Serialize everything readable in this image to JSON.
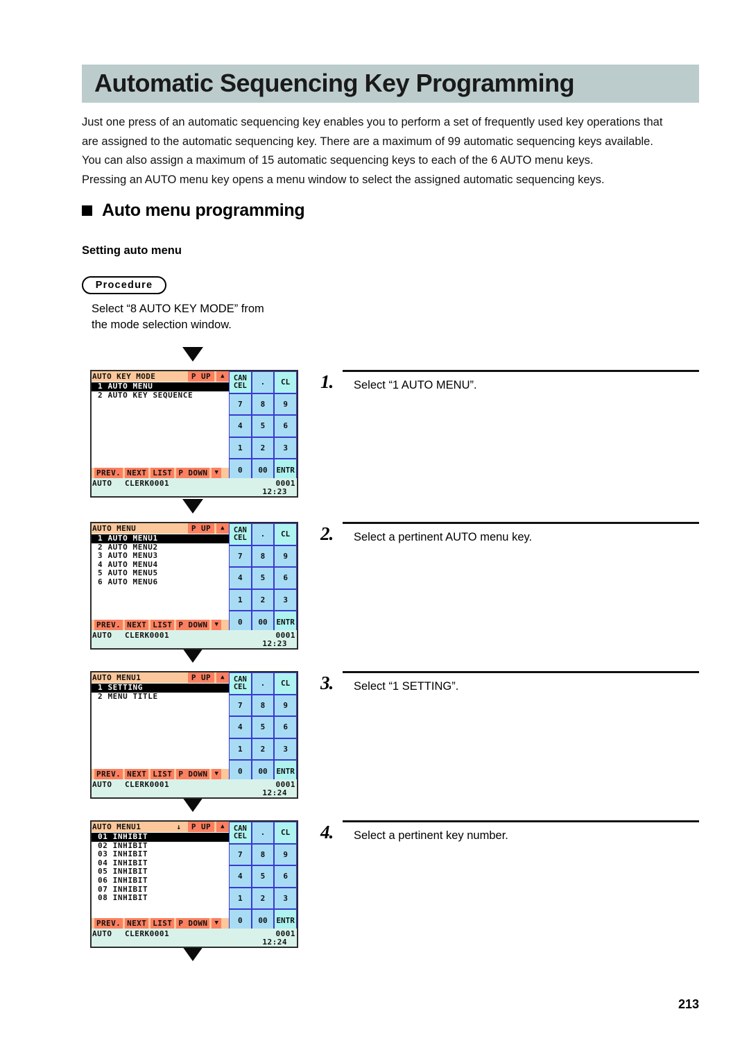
{
  "page": {
    "title": "Automatic Sequencing Key Programming",
    "page_number": "213",
    "banner_color": "#bccccd"
  },
  "intro": {
    "lines": [
      "Just one press of an automatic sequencing key enables you to perform a set of frequently used key operations that",
      "are assigned to the automatic sequencing key. There are a maximum of 99 automatic sequencing keys available.",
      "You can also assign a maximum of 15 automatic sequencing keys to each of the 6 AUTO menu keys.",
      "Pressing an AUTO menu key opens a menu window to select the assigned automatic sequencing keys."
    ]
  },
  "section": {
    "heading": "Auto menu programming",
    "subheading": "Setting auto menu",
    "procedure_badge": "Procedure",
    "lead_in_line1": "Select “8 AUTO KEY MODE” from",
    "lead_in_line2": "the mode selection window."
  },
  "steps": [
    {
      "number": "1.",
      "text": "Select “1 AUTO MENU”."
    },
    {
      "number": "2.",
      "text": "Select a pertinent AUTO menu key."
    },
    {
      "number": "3.",
      "text": "Select “1 SETTING”."
    },
    {
      "number": "4.",
      "text": "Select a pertinent key number."
    }
  ],
  "keypad": {
    "cancel_line1": "CAN",
    "cancel_line2": "CEL",
    "dot": ".",
    "clear": "CL",
    "k7": "7",
    "k8": "8",
    "k9": "9",
    "k4": "4",
    "k5": "5",
    "k6": "6",
    "k1": "1",
    "k2": "2",
    "k3": "3",
    "k0": "0",
    "k00": "00",
    "enter": "ENTR",
    "key_color": "#a8dcf5",
    "special_key_color": "#aef3f0",
    "key_border_color": "#3a3ad0"
  },
  "softkeys": {
    "prev": "PREV.",
    "next": "NEXT",
    "list": "LIST",
    "page_down": "P DOWN",
    "down_arrow": "▼",
    "page_up": "P UP",
    "up_arrow": "▲",
    "bar_color": "#fcc79a",
    "key_color": "#fc7f5f"
  },
  "screens": [
    {
      "id": "screen-auto-key-mode",
      "title": "AUTO KEY MODE",
      "scroll_indicator": "",
      "rows": [
        {
          "label": "1 AUTO MENU",
          "selected": true
        },
        {
          "label": "2 AUTO KEY SEQUENCE",
          "selected": false
        }
      ],
      "status": {
        "mode": "AUTO",
        "clerk": "CLERK0001",
        "number": "0001",
        "time": "12:23"
      }
    },
    {
      "id": "screen-auto-menu",
      "title": "AUTO MENU",
      "scroll_indicator": "",
      "rows": [
        {
          "label": "1 AUTO MENU1",
          "selected": true
        },
        {
          "label": "2 AUTO MENU2",
          "selected": false
        },
        {
          "label": "3 AUTO MENU3",
          "selected": false
        },
        {
          "label": "4 AUTO MENU4",
          "selected": false
        },
        {
          "label": "5 AUTO MENU5",
          "selected": false
        },
        {
          "label": "6 AUTO MENU6",
          "selected": false
        }
      ],
      "status": {
        "mode": "AUTO",
        "clerk": "CLERK0001",
        "number": "0001",
        "time": "12:23"
      }
    },
    {
      "id": "screen-auto-menu1",
      "title": "AUTO MENU1",
      "scroll_indicator": "",
      "rows": [
        {
          "label": "1 SETTING",
          "selected": true
        },
        {
          "label": "2 MENU TITLE",
          "selected": false
        }
      ],
      "status": {
        "mode": "AUTO",
        "clerk": "CLERK0001",
        "number": "0001",
        "time": "12:24"
      }
    },
    {
      "id": "screen-auto-menu1-keys",
      "title": "AUTO MENU1",
      "scroll_indicator": "↓",
      "rows": [
        {
          "label": "01 INHIBIT",
          "selected": true
        },
        {
          "label": "02 INHIBIT",
          "selected": false
        },
        {
          "label": "03 INHIBIT",
          "selected": false
        },
        {
          "label": "04 INHIBIT",
          "selected": false
        },
        {
          "label": "05 INHIBIT",
          "selected": false
        },
        {
          "label": "06 INHIBIT",
          "selected": false
        },
        {
          "label": "07 INHIBIT",
          "selected": false
        },
        {
          "label": "08 INHIBIT",
          "selected": false
        }
      ],
      "status": {
        "mode": "AUTO",
        "clerk": "CLERK0001",
        "number": "0001",
        "time": "12:24"
      }
    }
  ]
}
